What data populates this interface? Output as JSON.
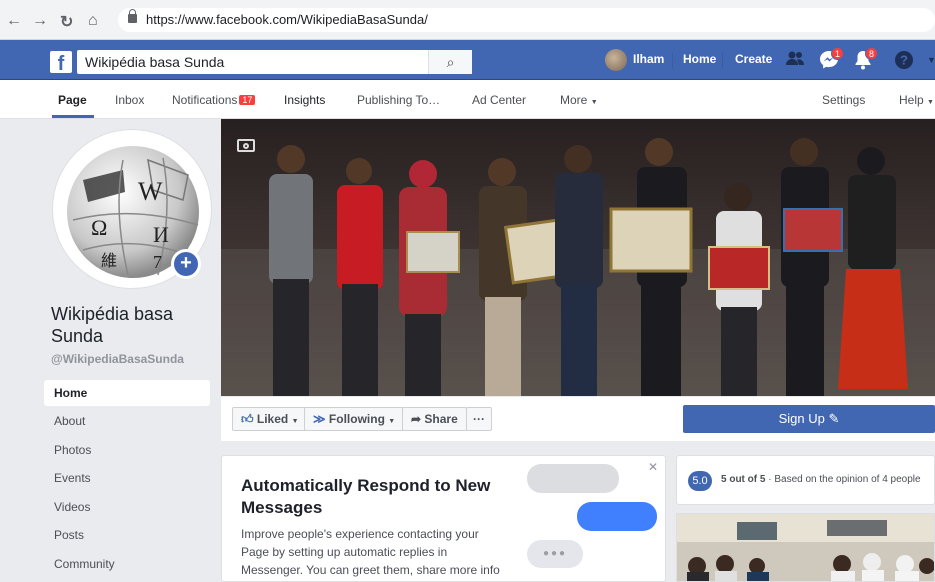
{
  "browser": {
    "url": "https://www.facebook.com/WikipediaBasaSunda/"
  },
  "fbbar": {
    "search_value": "Wikipédia basa Sunda",
    "user_name": "Ilham",
    "home_label": "Home",
    "create_label": "Create",
    "messages_count": "1",
    "notifications_count": "8"
  },
  "page_tabs": {
    "page": "Page",
    "inbox": "Inbox",
    "notifications": "Notifications",
    "notifications_count": "17",
    "insights": "Insights",
    "publishing_tools": "Publishing To…",
    "ad_center": "Ad Center",
    "more": "More",
    "settings": "Settings",
    "help": "Help"
  },
  "profile": {
    "name": "Wikipédia basa Sunda",
    "handle": "@WikipediaBasaSunda"
  },
  "left_nav": [
    "Home",
    "About",
    "Photos",
    "Events",
    "Videos",
    "Posts",
    "Community"
  ],
  "actions": {
    "liked": "Liked",
    "following": "Following",
    "share": "Share",
    "more": "···",
    "signup": "Sign Up"
  },
  "auto_respond": {
    "title": "Automatically Respond to New Messages",
    "body": "Improve people's experience contacting your Page by setting up automatic replies in Messenger. You can greet them, share more info"
  },
  "rating": {
    "score": "5.0",
    "text_bold": "5 out of 5",
    "text_rest": " · Based on the opinion of 4 people"
  },
  "colors": {
    "brand": "#4267b2",
    "badge": "#fa3e3e"
  }
}
